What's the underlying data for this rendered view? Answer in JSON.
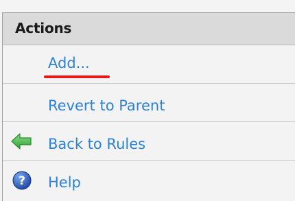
{
  "actions_panel": {
    "title": "Actions",
    "items": [
      {
        "label": "Add...",
        "icon": null,
        "highlighted": true
      },
      {
        "label": "Revert to Parent",
        "icon": null
      },
      {
        "label": "Back to Rules",
        "icon": "back-arrow-icon"
      },
      {
        "label": "Help",
        "icon": "help-icon"
      }
    ]
  },
  "colors": {
    "link": "#2b83d6",
    "header_bg": "#dadada",
    "highlight": "#e31b1b",
    "arrow_green": "#3cb43c",
    "help_blue": "#1f4fb8"
  }
}
